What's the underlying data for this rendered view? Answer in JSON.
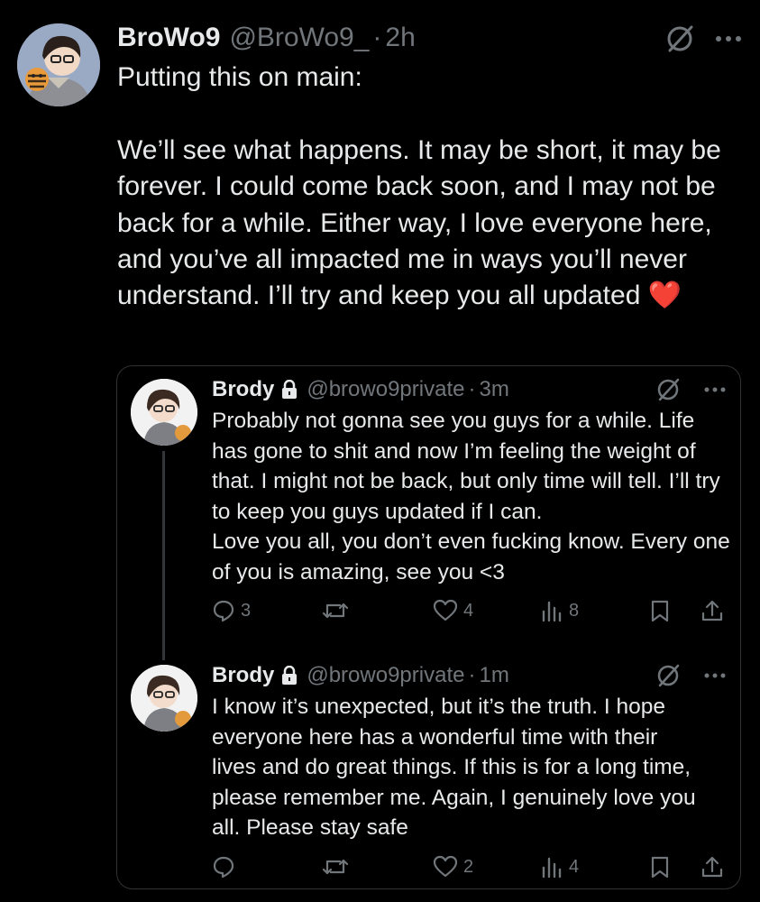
{
  "main_post": {
    "display_name": "BroWo9",
    "handle": "@BroWo9_",
    "dot": "·",
    "time": "2h",
    "text": "Putting this on main:\n\nWe’ll see what happens. It may be short, it may be forever. I could come back soon, and I may not be back for a while. Either way, I love everyone here, and you’ve all impacted me in ways you’ll never understand. I’ll try and keep you all updated",
    "emoji": "❤️",
    "icons": [
      "grok-icon",
      "more-icon"
    ]
  },
  "quoted_thread": [
    {
      "display_name": "Brody",
      "handle": "@browo9private",
      "dot": "·",
      "time": "3m",
      "text": "Probably not gonna see you guys for a while. Life has gone to shit and now I’m feeling the weight of that. I might not be back, but only time will tell. I’ll try to keep you guys updated if I can.\nLove you all, you don’t even fucking know. Every one of you is amazing, see you <3",
      "replies": "3",
      "reposts": "",
      "likes": "4",
      "views": "8"
    },
    {
      "display_name": "Brody",
      "handle": "@browo9private",
      "dot": "·",
      "time": "1m",
      "text": "I know it’s unexpected, but it’s the truth. I hope everyone here has a wonderful time with their lives and do great things. If this is for a long time, please remember me. Again, I genuinely love you all. Please stay safe",
      "replies": "",
      "reposts": "",
      "likes": "2",
      "views": "4"
    }
  ],
  "colors": {
    "background": "#000000",
    "text": "#e7e9ea",
    "muted": "#71767b",
    "border": "#2f3336",
    "heart": "#f91c41"
  }
}
